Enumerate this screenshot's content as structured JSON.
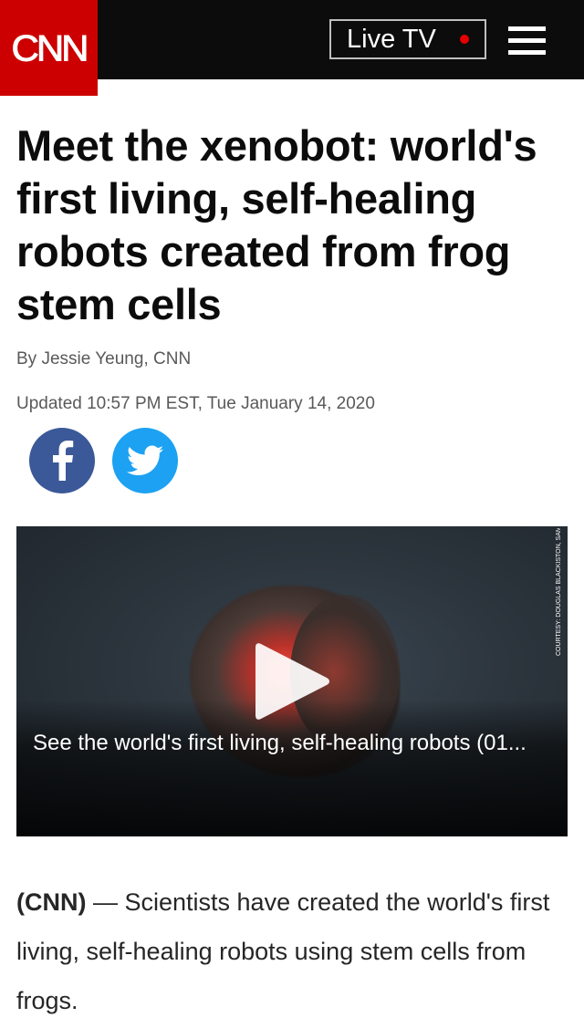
{
  "header": {
    "logo_text": "CNN",
    "live_tv_label": "Live TV",
    "brand_color": "#cc0000",
    "live_dot_color": "#e50000",
    "menu_icon": "hamburger-icon"
  },
  "article": {
    "headline": "Meet the xenobot: world's first living, self-healing robots created from frog stem cells",
    "byline": "By Jessie Yeung, CNN",
    "updated": "Updated 10:57 PM EST, Tue January 14, 2020",
    "share": [
      {
        "icon": "facebook-icon",
        "color": "#3b5998"
      },
      {
        "icon": "twitter-icon",
        "color": "#1da1f2"
      }
    ],
    "video": {
      "caption": "See the world's first living, self-healing robots (01...",
      "credit": "COURTESY: DOUGLAS BLACKISTON, SAM KRIEGMAN",
      "play_icon": "play-icon"
    },
    "lead_source": "(CNN)",
    "lead_dash": " — ",
    "lead_text": "Scientists have created the world's first living, self-healing robots using stem cells from frogs."
  }
}
